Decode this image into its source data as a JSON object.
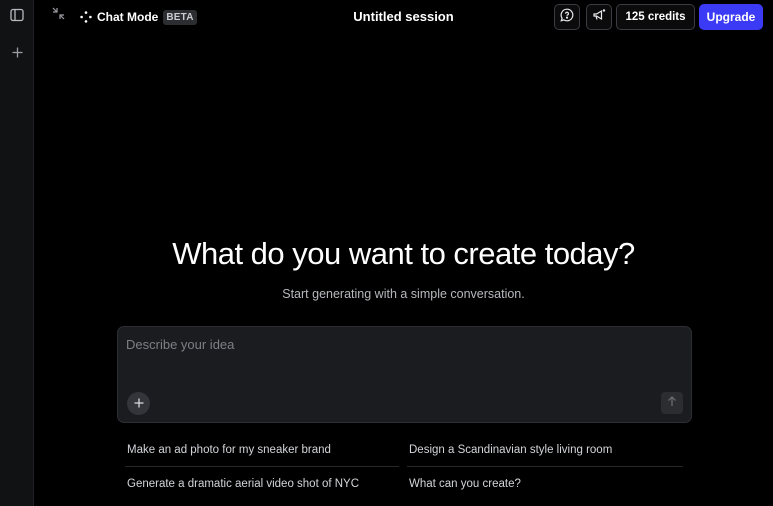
{
  "topbar": {
    "mode_label": "Chat Mode",
    "mode_badge": "BETA",
    "session_title": "Untitled session",
    "credits_label": "125 credits",
    "upgrade_label": "Upgrade"
  },
  "hero": {
    "title": "What do you want to create today?",
    "subtitle": "Start generating with a simple conversation."
  },
  "prompt": {
    "placeholder": "Describe your idea"
  },
  "suggestions": [
    "Make an ad photo for my sneaker brand",
    "Design a Scandinavian style living room",
    "Generate a dramatic aerial video shot of NYC",
    "What can you create?"
  ],
  "colors": {
    "accent": "#3b3bf5",
    "background": "#000000",
    "panel": "#1b1c1f"
  }
}
